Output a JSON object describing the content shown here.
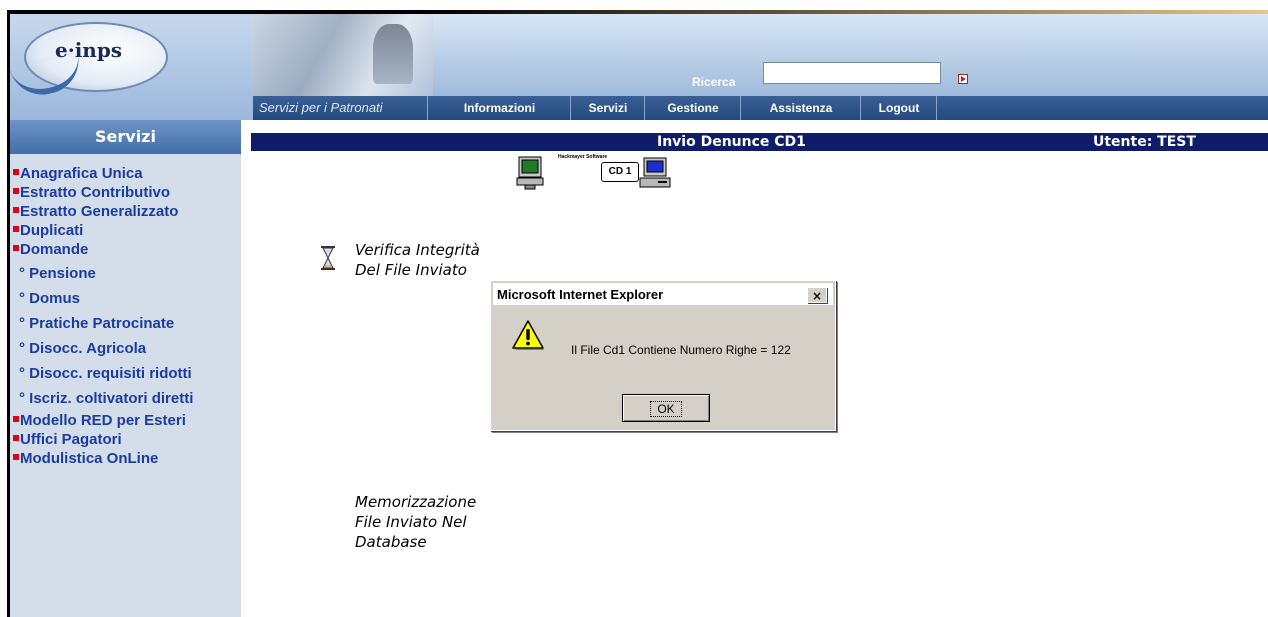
{
  "header": {
    "logo_text": "e·inps",
    "search_label": "Ricerca",
    "search_value": "",
    "tagline": "Servizi per i Patronati",
    "nav": [
      "Informazioni",
      "Servizi",
      "Gestione",
      "Assistenza",
      "Logout"
    ]
  },
  "sidebar": {
    "title": "Servizi",
    "items": [
      "Anagrafica Unica",
      "Estratto Contributivo",
      "Estratto Generalizzato",
      "Duplicati",
      "Domande"
    ],
    "subitems": [
      "° Pensione",
      "° Domus",
      "° Pratiche Patrocinate",
      "° Disocc. Agricola",
      "° Disocc. requisiti ridotti",
      "° Iscriz. coltivatori diretti"
    ],
    "items_after": [
      "Modello RED per Esteri",
      "Uffici Pagatori",
      "Modulistica OnLine"
    ]
  },
  "content": {
    "title": "Invio Denunce CD1",
    "user": "Utente: TEST",
    "brand_tiny": "Hackmayer Software",
    "cd_label": "CD 1",
    "step1_line1": "Verifica Integrità",
    "step1_line2": "Del File Inviato",
    "step2_line1": "Memorizzazione",
    "step2_line2": "File Inviato Nel",
    "step2_line3": "Database"
  },
  "dialog": {
    "title": "Microsoft Internet Explorer",
    "close": "×",
    "message": "Il File Cd1 Contiene Numero Righe = 122",
    "ok": "OK"
  }
}
